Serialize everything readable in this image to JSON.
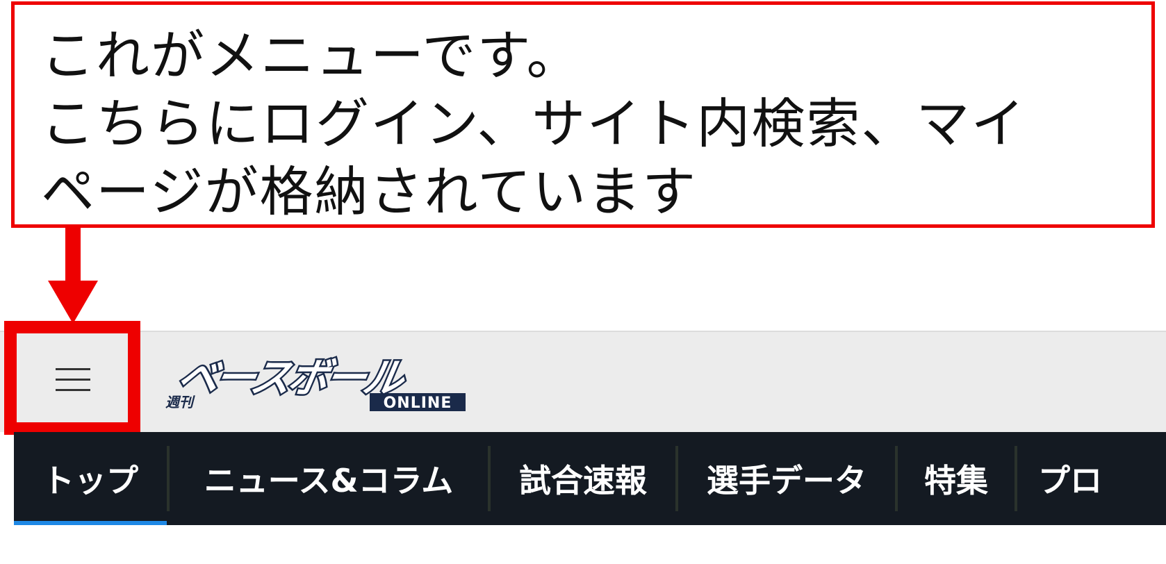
{
  "annotation": {
    "lines": [
      "これがメニューです。",
      "こちらにログイン、サイト内検索、マイ",
      "ページが格納されています"
    ],
    "accent_color": "#ee0000"
  },
  "header": {
    "menu_icon": "hamburger-menu-icon",
    "logo": {
      "prefix": "週刊",
      "name": "ベースボール",
      "suffix": "ONLINE",
      "logo_color": "#1a2a4a"
    }
  },
  "nav": {
    "items": [
      {
        "label": "トップ",
        "active": true
      },
      {
        "label": "ニュース&コラム"
      },
      {
        "label": "試合速報"
      },
      {
        "label": "選手データ"
      },
      {
        "label": "特集"
      },
      {
        "label": "プロ"
      }
    ],
    "background": "#141a22",
    "active_color": "#1e88e5"
  }
}
